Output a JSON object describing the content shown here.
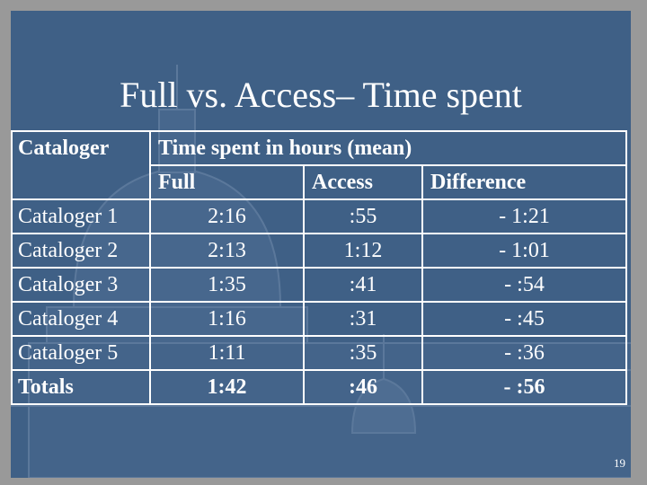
{
  "slide": {
    "title": "Full vs. Access– Time spent",
    "page_number": "19"
  },
  "table": {
    "header": {
      "col0": "Cataloger",
      "group": "Time spent in hours (mean)",
      "sub": [
        "Full",
        "Access",
        "Difference"
      ]
    },
    "rows": [
      {
        "cataloger": "Cataloger 1",
        "full": "2:16",
        "access": ":55",
        "difference": "- 1:21"
      },
      {
        "cataloger": "Cataloger 2",
        "full": "2:13",
        "access": "1:12",
        "difference": "- 1:01"
      },
      {
        "cataloger": "Cataloger 3",
        "full": "1:35",
        "access": ":41",
        "difference": "- :54"
      },
      {
        "cataloger": "Cataloger 4",
        "full": "1:16",
        "access": ":31",
        "difference": "- :45"
      },
      {
        "cataloger": "Cataloger 5",
        "full": "1:11",
        "access": ":35",
        "difference": "- :36"
      }
    ],
    "totals": {
      "label": "Totals",
      "full": "1:42",
      "access": ":46",
      "difference": "- :56"
    }
  },
  "colors": {
    "slide_background": "#3f6086",
    "outer_background": "#999999",
    "text": "#ffffff",
    "table_border": "#ffffff"
  }
}
